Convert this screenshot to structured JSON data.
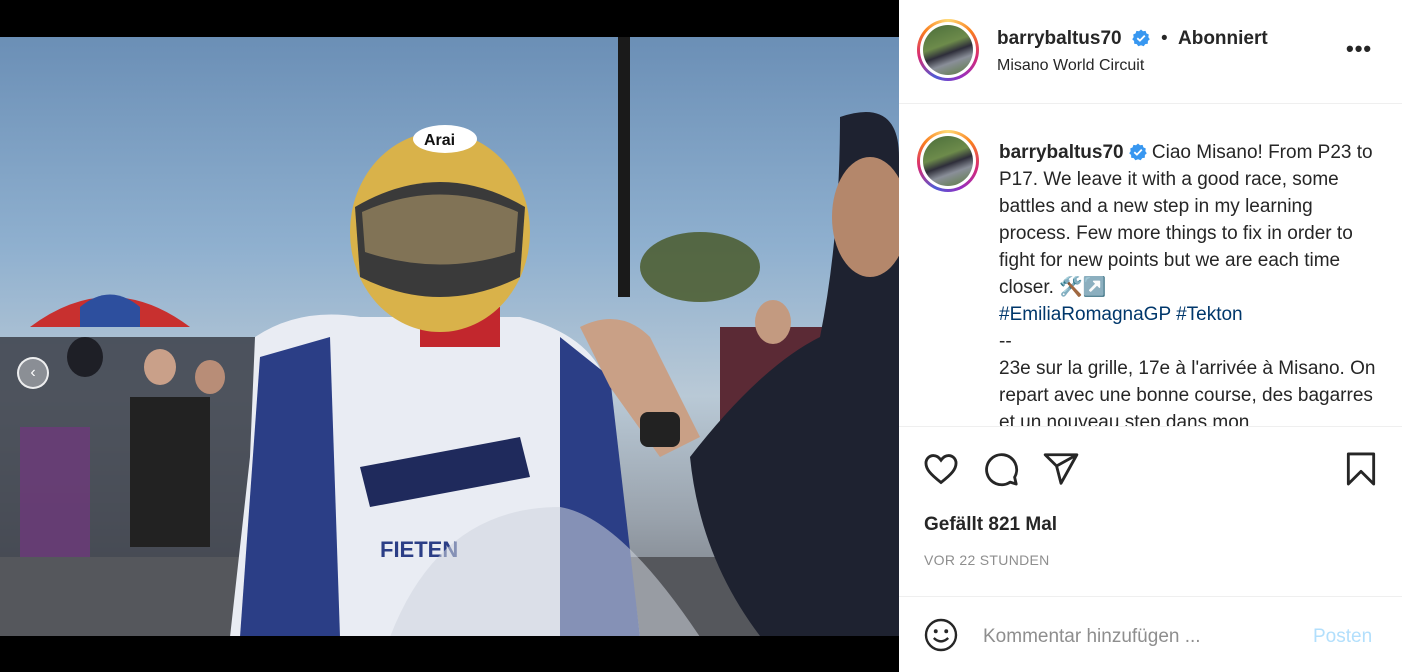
{
  "post": {
    "username": "barrybaltus70",
    "follow_status": "Abonniert",
    "separator": "•",
    "location": "Misano World Circuit",
    "more_label": "•••",
    "caption_text": " Ciao Misano! From P23 to P17. We leave it with a good race, some battles and a new step in my learning process. Few more things to fix in order to fight for new points but we are each time closer. 🛠️↗️\n",
    "hashtag_1": "#EmiliaRomagnaGP",
    "hashtag_2": "#Tekton",
    "caption_text_2": "\n--\n23e sur la grille, 17e à l'arrivée à Misano. On repart avec une bonne course, des bagarres et un nouveau step dans mon",
    "likes": "Gefällt 821 Mal",
    "timestamp": "VOR 22 STUNDEN"
  },
  "comment": {
    "placeholder": "Kommentar hinzufügen ...",
    "post_label": "Posten"
  },
  "media": {
    "prev_label": "‹"
  },
  "colors": {
    "verified": "#3897f0",
    "hashtag": "#00376b",
    "post_button_disabled": "#b2dffc"
  },
  "icons": [
    "heart-icon",
    "comment-icon",
    "share-icon",
    "bookmark-icon",
    "emoji-icon",
    "verified-icon",
    "chevron-left-icon"
  ]
}
